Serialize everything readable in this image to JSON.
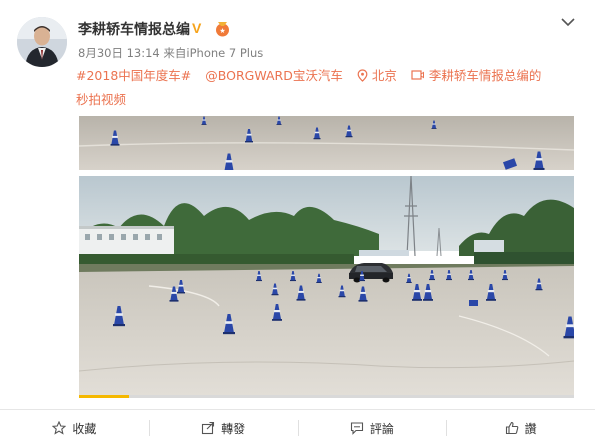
{
  "post": {
    "author": "李耕轿车情报总编",
    "verified_badge": "V",
    "meta": "8月30日 13:14 来自iPhone 7 Plus",
    "hashtag": "#2018中国年度车#",
    "mention": "@BORGWARD宝沃汽车",
    "location": "北京",
    "video_label_line1": "李耕轿车情报总编的",
    "video_label_line2": "秒拍视频"
  },
  "video": {
    "progress": 0.1
  },
  "actions": [
    {
      "label": "收藏",
      "icon": "star-icon"
    },
    {
      "label": "轉發",
      "icon": "share-icon"
    },
    {
      "label": "評論",
      "icon": "comment-icon"
    },
    {
      "label": "讚",
      "icon": "thumbs-up-icon"
    }
  ],
  "colors": {
    "accent": "#eb7350",
    "verified": "#f6a31b",
    "progress": "#f5b800"
  }
}
